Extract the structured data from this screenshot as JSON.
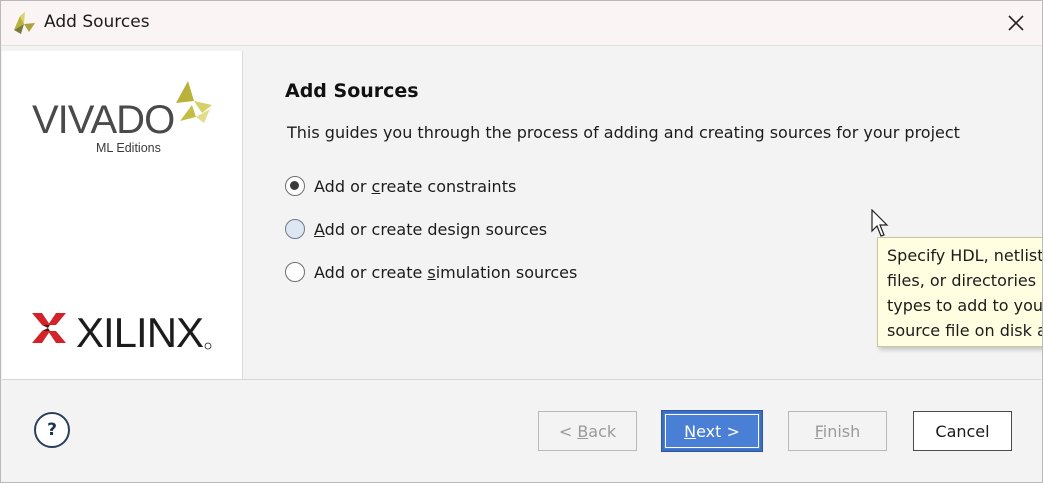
{
  "window": {
    "title": "Add Sources"
  },
  "logos": {
    "vivado": "VIVADO",
    "vivado_sub": "ML Editions",
    "xilinx": "XILINX"
  },
  "content": {
    "title": "Add Sources",
    "description": "This guides you through the process of adding and creating sources for your project"
  },
  "options": [
    {
      "pre": "Add or ",
      "mnemonic": "c",
      "post": "reate constraints",
      "checked": true
    },
    {
      "pre": "",
      "mnemonic": "A",
      "post": "dd or create design sources",
      "checked": false
    },
    {
      "pre": "Add or create ",
      "mnemonic": "s",
      "post": "imulation sources",
      "checked": false
    }
  ],
  "tooltip": {
    "lines": [
      "Specify HDL, netlist,",
      "files, or directories c",
      "types to add to you",
      "source file on disk a"
    ]
  },
  "footer": {
    "help_label": "?",
    "back": {
      "pre": "< ",
      "mnemonic": "B",
      "post": "ack"
    },
    "next": {
      "pre": "",
      "mnemonic": "N",
      "post": "ext >"
    },
    "finish": {
      "pre": "",
      "mnemonic": "F",
      "post": "inish"
    },
    "cancel": "Cancel"
  },
  "colors": {
    "accent": "#4a7fd6",
    "tooltip_bg": "#fffee1",
    "xilinx_red": "#d3222a",
    "vivado_yellow": "#c8c13a"
  }
}
